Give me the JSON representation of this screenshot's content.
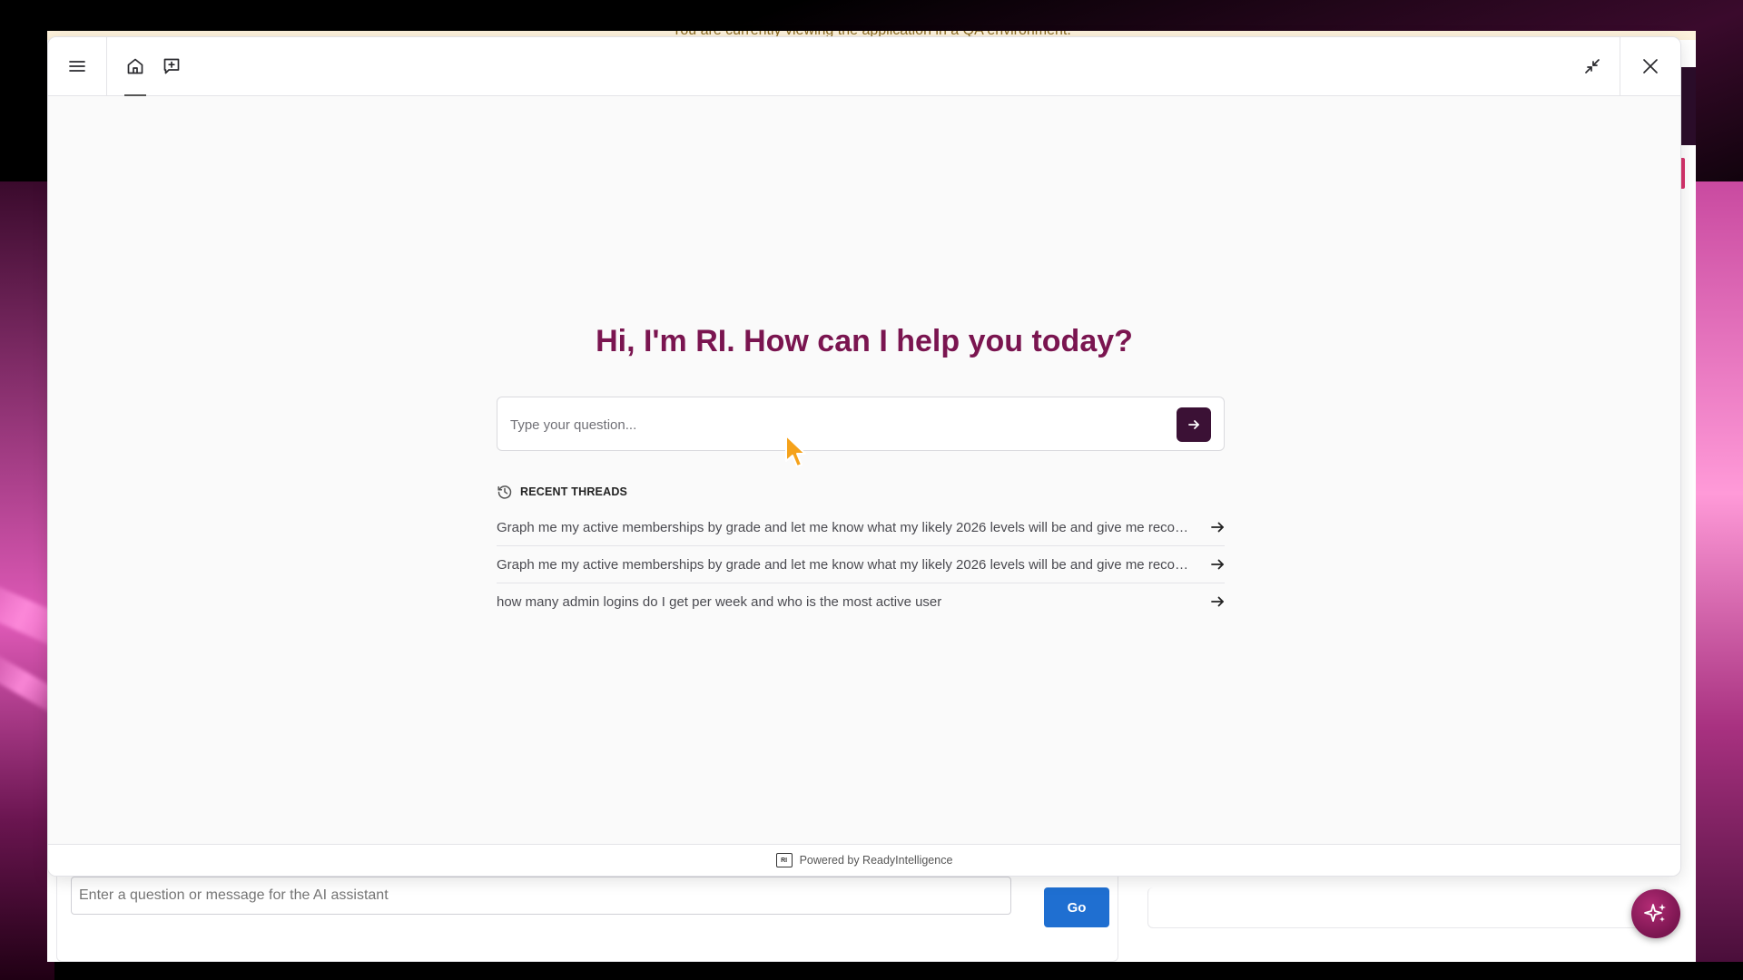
{
  "background_page": {
    "qa_banner": "You are currently viewing the application in a QA environment.",
    "input_placeholder": "Enter a question or message for the AI assistant",
    "go_button_label": "Go"
  },
  "modal": {
    "header": {
      "menu_icon": "hamburger-menu-icon",
      "home_icon": "home-icon",
      "new_thread_icon": "new-chat-icon",
      "minimize_icon": "minimize-icon",
      "close_icon": "close-icon"
    },
    "greeting": "Hi, I'm RI. How can I help you today?",
    "question_input": {
      "value": "",
      "placeholder": "Type your question..."
    },
    "send_icon": "arrow-right-icon",
    "recent_threads": {
      "label": "RECENT THREADS",
      "icon": "history-clock-icon",
      "items": [
        {
          "text": "Graph me my active memberships by grade and let me know what my likely 2026 levels will be and give me recommendations"
        },
        {
          "text": "Graph me my active memberships by grade and let me know what my likely 2026 levels will be and give me recommendations"
        },
        {
          "text": "how many admin logins do I get per week and who is the most active user"
        }
      ]
    },
    "footer": {
      "logo_text": "RI",
      "powered_by": "Powered by ReadyIntelligence"
    }
  },
  "fab_icon": "sparkles-icon",
  "colors": {
    "brand_primary": "#7a1550",
    "send_button": "#3b1135",
    "go_button": "#1f6fd1"
  }
}
